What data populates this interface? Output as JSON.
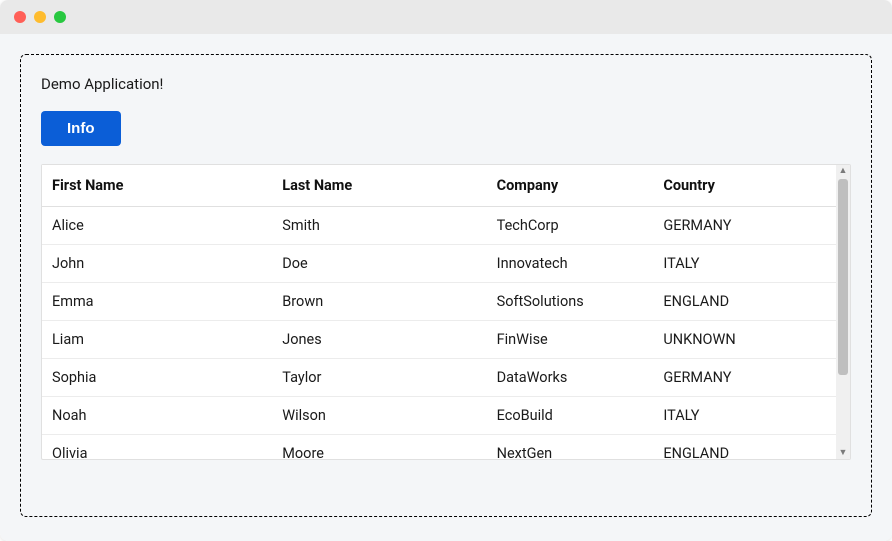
{
  "app": {
    "title": "Demo Application!"
  },
  "buttons": {
    "info": "Info"
  },
  "grid": {
    "headers": {
      "first_name": "First Name",
      "last_name": "Last Name",
      "company": "Company",
      "country": "Country"
    },
    "rows": [
      {
        "first": "Alice",
        "last": "Smith",
        "company": "TechCorp",
        "country": "GERMANY"
      },
      {
        "first": "John",
        "last": "Doe",
        "company": "Innovatech",
        "country": "ITALY"
      },
      {
        "first": "Emma",
        "last": "Brown",
        "company": "SoftSolutions",
        "country": "ENGLAND"
      },
      {
        "first": "Liam",
        "last": "Jones",
        "company": "FinWise",
        "country": "UNKNOWN"
      },
      {
        "first": "Sophia",
        "last": "Taylor",
        "company": "DataWorks",
        "country": "GERMANY"
      },
      {
        "first": "Noah",
        "last": "Wilson",
        "company": "EcoBuild",
        "country": "ITALY"
      },
      {
        "first": "Olivia",
        "last": "Moore",
        "company": "NextGen",
        "country": "ENGLAND"
      }
    ]
  }
}
